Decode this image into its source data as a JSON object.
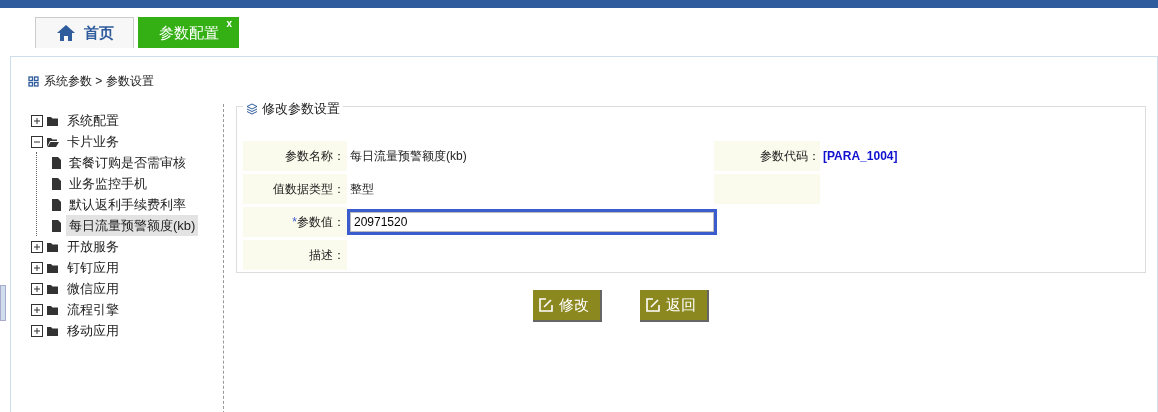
{
  "tabs": [
    {
      "label": "首页",
      "kind": "home",
      "selected": false
    },
    {
      "label": "参数配置",
      "kind": "page",
      "selected": true,
      "close": "x"
    }
  ],
  "breadcrumb": "系统参数 > 参数设置",
  "tree": [
    {
      "label": "系统配置",
      "expanded": false,
      "selected": false
    },
    {
      "label": "卡片业务",
      "expanded": true,
      "selected": false,
      "children": [
        {
          "label": "套餐订购是否需审核",
          "selected": false
        },
        {
          "label": "业务监控手机",
          "selected": false
        },
        {
          "label": "默认返利手续费利率",
          "selected": false
        },
        {
          "label": "每日流量预警额度(kb)",
          "selected": true
        }
      ]
    },
    {
      "label": "开放服务",
      "expanded": false,
      "selected": false
    },
    {
      "label": "钉钉应用",
      "expanded": false,
      "selected": false
    },
    {
      "label": "微信应用",
      "expanded": false,
      "selected": false
    },
    {
      "label": "流程引擎",
      "expanded": false,
      "selected": false
    },
    {
      "label": "移动应用",
      "expanded": false,
      "selected": false
    }
  ],
  "form": {
    "legend": "修改参数设置",
    "rows": [
      {
        "kind": "pair",
        "label": "参数名称：",
        "value": "每日流量预警额度(kb)",
        "label2": "参数代码：",
        "value2": "[PARA_1004]"
      },
      {
        "kind": "pair",
        "label": "值数据类型：",
        "value": "整型"
      },
      {
        "kind": "input",
        "required_mark": "*",
        "label": "参数值：",
        "value": "20971520",
        "highlighted": true
      },
      {
        "kind": "text",
        "label": "描述："
      }
    ]
  },
  "buttons": [
    {
      "label": "修改"
    },
    {
      "label": "返回"
    }
  ]
}
